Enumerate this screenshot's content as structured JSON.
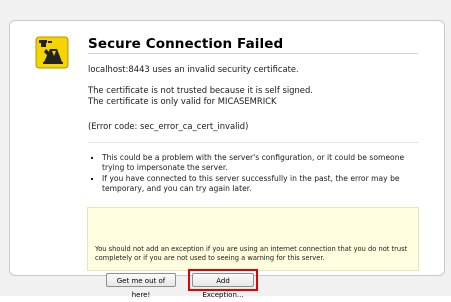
{
  "page": {
    "title": "Secure Connection Failed",
    "message": "localhost:8443 uses an invalid security certificate.",
    "cert_line1": "The certificate is not trusted because it is self signed.",
    "cert_line2": "The certificate is only valid for MICASEMRICK",
    "error_code": "(Error code: sec_error_ca_cert_invalid)",
    "bullets": [
      "This could be a problem with the server's configuration, or it could be someone trying to impersonate the server.",
      "If you have connected to this server successfully in the past, the error may be temporary, and you can try again later."
    ]
  },
  "warning": {
    "text": "You should not add an exception if you are using an internet connection that you do not trust completely or if you are not used to seeing a warning for this server.",
    "get_out_label": "Get me out of here!",
    "add_exception_label": "Add Exception..."
  },
  "colors": {
    "highlight": "#e30000",
    "warning_bg": "#ffffe0"
  },
  "icons": {
    "header": "policeman-stop-icon"
  }
}
